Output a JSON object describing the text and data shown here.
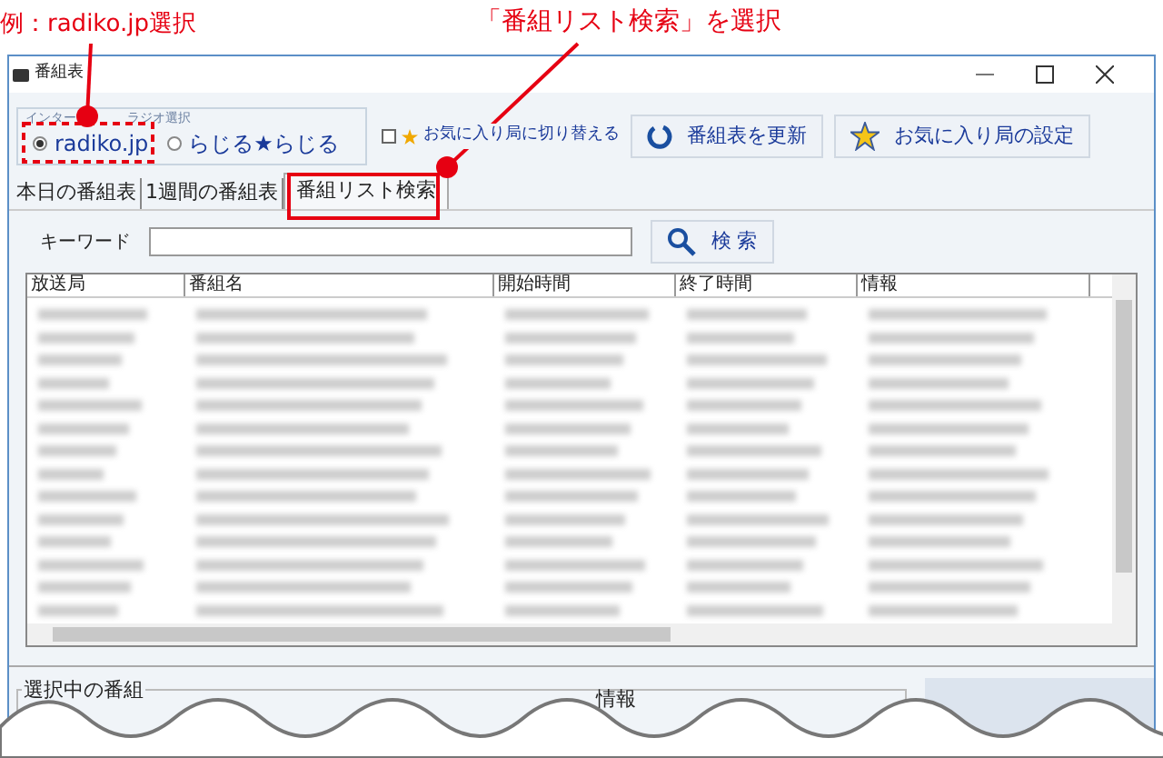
{
  "annotations": [
    {
      "text": "例：radiko.jp選択"
    },
    {
      "text": "「番組リスト検索」を選択"
    }
  ],
  "window": {
    "title": "番組表"
  },
  "radio_group": {
    "label_parts": [
      "インター",
      "ラジオ選択"
    ],
    "options": [
      {
        "label": "radiko.jp",
        "selected": true
      },
      {
        "label": "らじる★らじる",
        "selected": false
      }
    ]
  },
  "favorites_toggle": {
    "label": "お気に入り局に切り替える",
    "checked": false
  },
  "buttons": [
    {
      "label": "番組表を更新",
      "kind": "refresh"
    },
    {
      "label": "お気に入り局の設定",
      "kind": "star"
    }
  ],
  "tabs": [
    {
      "label": "本日の番組表",
      "selected": false
    },
    {
      "label": "1週間の番組表",
      "selected": false
    },
    {
      "label": "番組リスト検索",
      "selected": true
    }
  ],
  "search": {
    "label": "キーワード",
    "button": "検 索"
  },
  "table": {
    "columns": [
      "放送局",
      "番組名",
      "開始時間",
      "終了時間",
      "情報"
    ]
  },
  "selected_program": {
    "title": "選択中の番組",
    "info_label": "情報"
  }
}
